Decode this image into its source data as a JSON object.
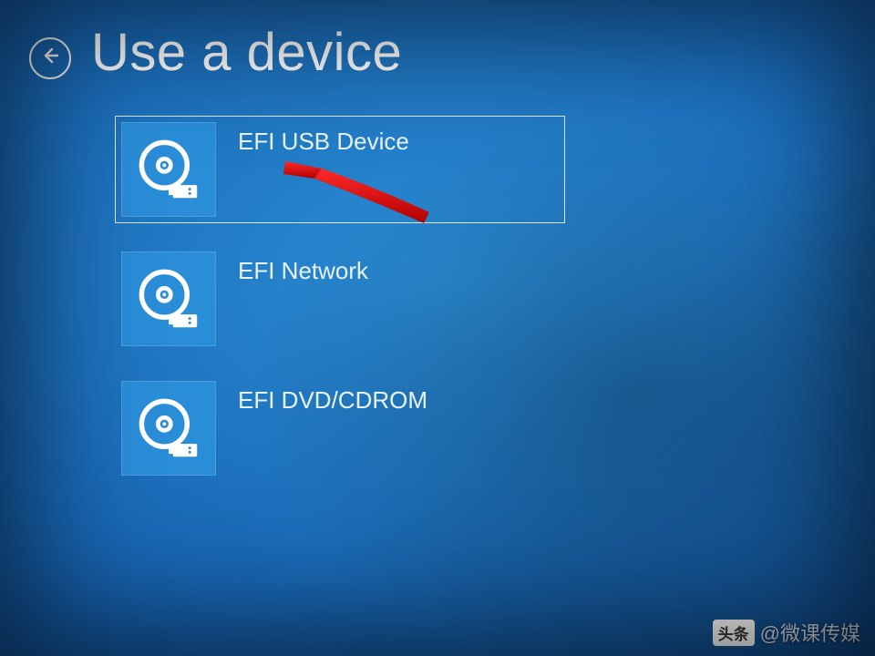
{
  "header": {
    "title": "Use a device",
    "back_icon": "arrow-left"
  },
  "devices": [
    {
      "label": "EFI USB Device",
      "selected": true
    },
    {
      "label": "EFI Network",
      "selected": false
    },
    {
      "label": "EFI DVD/CDROM",
      "selected": false
    }
  ],
  "annotation": {
    "type": "red-arrow",
    "points_to": "EFI USB Device"
  },
  "watermark": {
    "badge": "头条",
    "text": "@微课传媒"
  }
}
